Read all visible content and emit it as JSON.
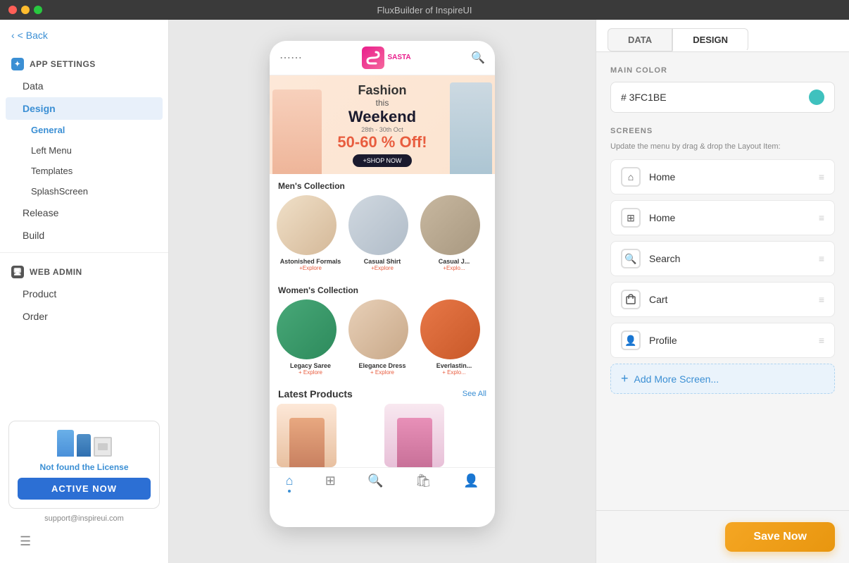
{
  "titlebar": {
    "title": "FluxBuilder of InspireUI"
  },
  "sidebar": {
    "back_label": "< Back",
    "app_settings_header": "APP SETTINGS",
    "items": [
      {
        "id": "data",
        "label": "Data"
      },
      {
        "id": "design",
        "label": "Design",
        "active": true
      },
      {
        "id": "general",
        "label": "General",
        "sub": true,
        "active": true
      },
      {
        "id": "left-menu",
        "label": "Left Menu",
        "sub": true
      },
      {
        "id": "templates",
        "label": "Templates",
        "sub": true
      },
      {
        "id": "splashscreen",
        "label": "SplashScreen",
        "sub": true
      }
    ],
    "release_label": "Release",
    "build_label": "Build",
    "web_admin_header": "WEB ADMIN",
    "web_admin_items": [
      {
        "id": "product",
        "label": "Product"
      },
      {
        "id": "order",
        "label": "Order"
      }
    ],
    "license_text": "Not found the License",
    "active_btn_label": "ACTIVE NOW",
    "support_email": "support@inspireui.com"
  },
  "phone_preview": {
    "logo_letter": "S",
    "logo_name": "SASTA",
    "banner": {
      "line1": "Fashion",
      "line2": "this",
      "line3": "Weekend",
      "dates": "28th - 30th Oct",
      "discount": "50-60 % Off!",
      "btn_label": "+SHOP NOW"
    },
    "mens_section": "Men's Collection",
    "mens_items": [
      {
        "name": "Astonished Formals",
        "sub": "+Explore"
      },
      {
        "name": "Casual Shirt",
        "sub": "+Explore"
      },
      {
        "name": "Casual J...",
        "sub": "+Explo..."
      }
    ],
    "womens_section": "Women's Collection",
    "womens_items": [
      {
        "name": "Legacy Saree",
        "sub": "+ Explore"
      },
      {
        "name": "Elegance Dress",
        "sub": "+ Explore"
      },
      {
        "name": "Everlastin...",
        "sub": "+ Explo..."
      }
    ],
    "latest_title": "Latest Products",
    "see_all": "See All",
    "bottom_nav": [
      {
        "icon": "⌂",
        "active": true
      },
      {
        "icon": "⊞",
        "active": false
      },
      {
        "icon": "⌕",
        "active": false
      },
      {
        "icon": "🛍",
        "active": false
      },
      {
        "icon": "👤",
        "active": false
      }
    ]
  },
  "right_panel": {
    "tab_data": "DATA",
    "tab_design": "DESIGN",
    "main_color_label": "MAIN COLOR",
    "color_value": "# 3FC1BE",
    "color_hex": "#3FC1BE",
    "screens_label": "SCREENS",
    "screens_subtitle": "Update the menu by drag & drop the Layout Item:",
    "screens": [
      {
        "id": "home1",
        "icon": "⌂",
        "name": "Home"
      },
      {
        "id": "home2",
        "icon": "⊞",
        "name": "Home"
      },
      {
        "id": "search",
        "icon": "🔍",
        "name": "Search"
      },
      {
        "id": "cart",
        "icon": "🛍",
        "name": "Cart"
      },
      {
        "id": "profile",
        "icon": "👤",
        "name": "Profile"
      }
    ],
    "add_screen_label": "Add More Screen...",
    "save_btn_label": "Save Now"
  }
}
